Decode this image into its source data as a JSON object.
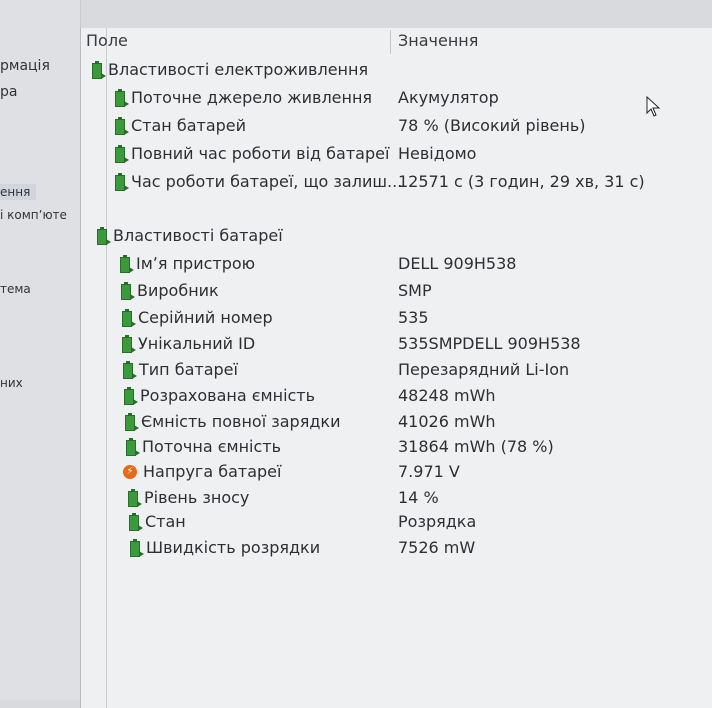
{
  "sidebar": {
    "items": [
      {
        "label": "рмація"
      },
      {
        "label": "ра"
      },
      {
        "label": "ення"
      },
      {
        "label": "і компʼюте"
      },
      {
        "label": "тема"
      },
      {
        "label": "них"
      }
    ]
  },
  "table": {
    "columns": {
      "field": "Поле",
      "value": "Значення"
    },
    "sections": [
      {
        "title": "Властивості електроживлення",
        "rows": [
          {
            "label": "Поточне джерело живлення",
            "value": "Акумулятор"
          },
          {
            "label": "Стан батарей",
            "value": "78 % (Високий рівень)"
          },
          {
            "label": "Повний час роботи від батареї",
            "value": "Невідомо"
          },
          {
            "label": "Час роботи батареї, що залиш...",
            "value": "12571 с (3 годин, 29 хв, 31 с)"
          }
        ]
      },
      {
        "title": "Властивості батареї",
        "rows": [
          {
            "label": "Імʼя пристрою",
            "value": "DELL 909H538"
          },
          {
            "label": "Виробник",
            "value": "SMP"
          },
          {
            "label": "Серійний номер",
            "value": "535"
          },
          {
            "label": "Унікальний ID",
            "value": "535SMPDELL 909H538"
          },
          {
            "label": "Тип батареї",
            "value": "Перезарядний Li-Ion"
          },
          {
            "label": "Розрахована ємність",
            "value": "48248 mWh"
          },
          {
            "label": "Ємність повної зарядки",
            "value": "41026 mWh"
          },
          {
            "label": "Поточна ємність",
            "value": "31864 mWh  (78 %)"
          },
          {
            "label": "Напруга батареї",
            "value": "7.971 V",
            "icon": "voltage-icon"
          },
          {
            "label": "Рівень зносу",
            "value": "14 %"
          },
          {
            "label": "Стан",
            "value": "Розрядка"
          },
          {
            "label": "Швидкість розрядки",
            "value": "7526 mW"
          }
        ]
      }
    ]
  },
  "colors": {
    "battery_icon": "#3b9a3b",
    "voltage_icon": "#e46a1c",
    "panel_bg": "#eef0f2"
  }
}
